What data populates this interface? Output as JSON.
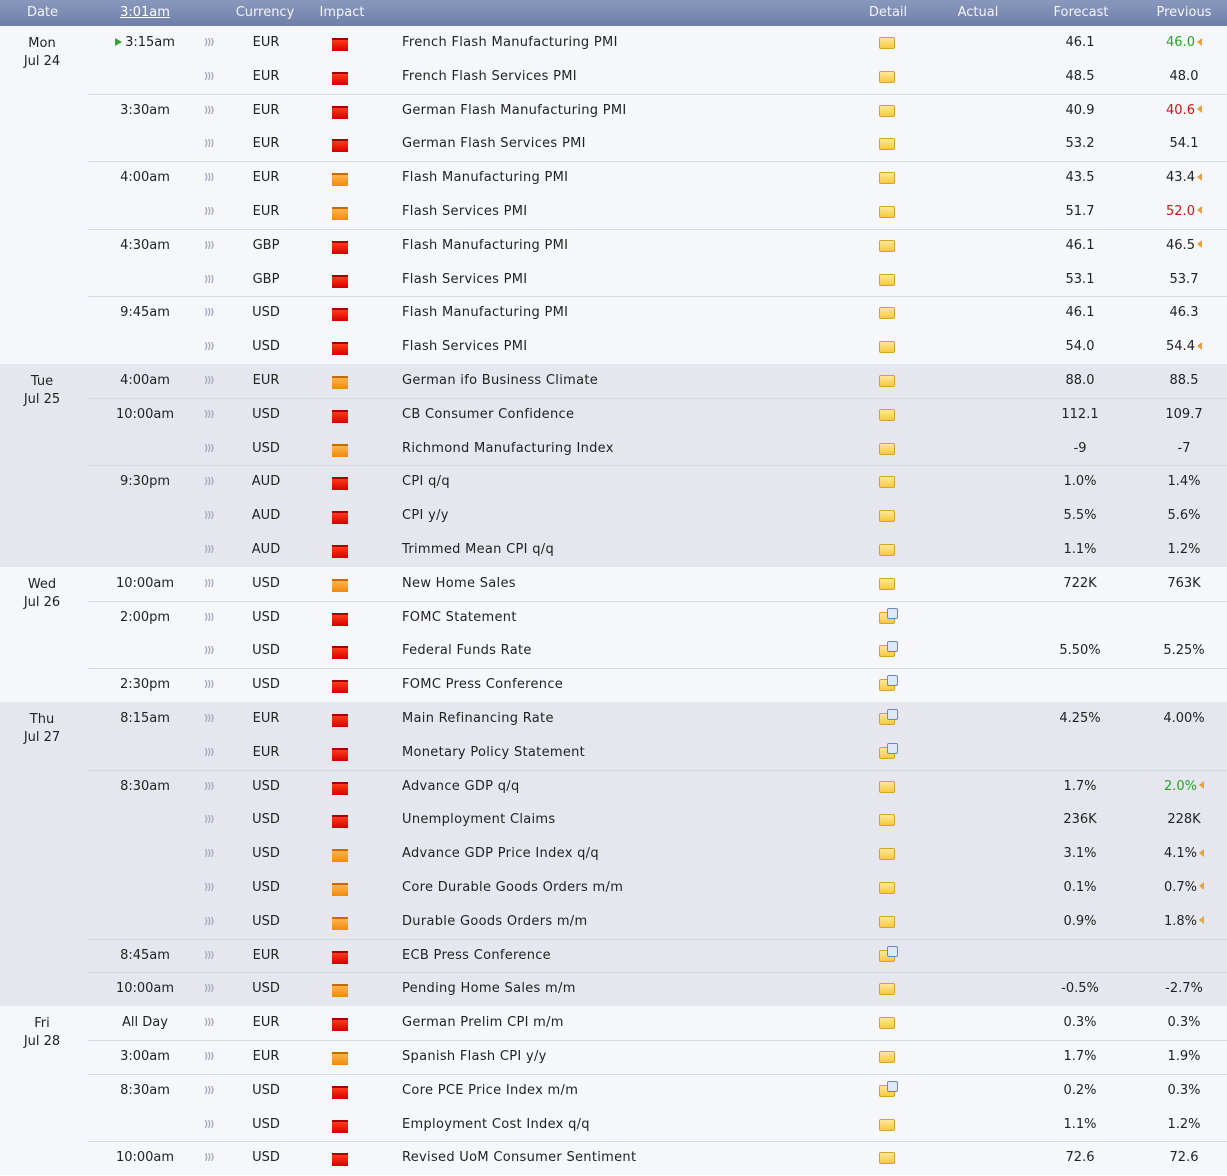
{
  "header": {
    "date": "Date",
    "time": "3:01am",
    "currency": "Currency",
    "impact": "Impact",
    "detail": "Detail",
    "actual": "Actual",
    "forecast": "Forecast",
    "previous": "Previous"
  },
  "colors": {
    "header_bg": "#7b89b0",
    "high_impact": "#e00000",
    "medium_impact": "#f59a20",
    "better": "#2aa12a",
    "worse": "#cc1515",
    "revised_marker": "#f0a030"
  },
  "days": [
    {
      "day": "Mon",
      "date": "Jul 24",
      "shade": "light",
      "rows": [
        {
          "time": "3:15am",
          "current": true,
          "currency": "EUR",
          "impact": "high",
          "title": "French Flash Manufacturing PMI",
          "detail": "folder",
          "forecast": "46.1",
          "previous": "46.0",
          "prev_color": "green",
          "revised": true,
          "sep": true
        },
        {
          "time": "",
          "currency": "EUR",
          "impact": "high",
          "title": "French Flash Services PMI",
          "detail": "folder",
          "forecast": "48.5",
          "previous": "48.0"
        },
        {
          "time": "3:30am",
          "currency": "EUR",
          "impact": "high",
          "title": "German Flash Manufacturing PMI",
          "detail": "folder",
          "forecast": "40.9",
          "previous": "40.6",
          "prev_color": "red",
          "revised": true,
          "sep": true
        },
        {
          "time": "",
          "currency": "EUR",
          "impact": "high",
          "title": "German Flash Services PMI",
          "detail": "folder",
          "forecast": "53.2",
          "previous": "54.1"
        },
        {
          "time": "4:00am",
          "currency": "EUR",
          "impact": "med",
          "title": "Flash Manufacturing PMI",
          "detail": "folder",
          "forecast": "43.5",
          "previous": "43.4",
          "revised": true,
          "sep": true
        },
        {
          "time": "",
          "currency": "EUR",
          "impact": "med",
          "title": "Flash Services PMI",
          "detail": "folder",
          "forecast": "51.7",
          "previous": "52.0",
          "prev_color": "red",
          "revised": true
        },
        {
          "time": "4:30am",
          "currency": "GBP",
          "impact": "high",
          "title": "Flash Manufacturing PMI",
          "detail": "folder",
          "forecast": "46.1",
          "previous": "46.5",
          "revised": true,
          "sep": true
        },
        {
          "time": "",
          "currency": "GBP",
          "impact": "high",
          "title": "Flash Services PMI",
          "detail": "folder",
          "forecast": "53.1",
          "previous": "53.7"
        },
        {
          "time": "9:45am",
          "currency": "USD",
          "impact": "high",
          "title": "Flash Manufacturing PMI",
          "detail": "folder",
          "forecast": "46.1",
          "previous": "46.3",
          "sep": true
        },
        {
          "time": "",
          "currency": "USD",
          "impact": "high",
          "title": "Flash Services PMI",
          "detail": "folder",
          "forecast": "54.0",
          "previous": "54.4",
          "revised": true
        }
      ]
    },
    {
      "day": "Tue",
      "date": "Jul 25",
      "shade": "dark",
      "rows": [
        {
          "time": "4:00am",
          "currency": "EUR",
          "impact": "med",
          "title": "German ifo Business Climate",
          "detail": "folder",
          "forecast": "88.0",
          "previous": "88.5",
          "sep": true
        },
        {
          "time": "10:00am",
          "currency": "USD",
          "impact": "high",
          "title": "CB Consumer Confidence",
          "detail": "folder",
          "forecast": "112.1",
          "previous": "109.7",
          "sep": true
        },
        {
          "time": "",
          "currency": "USD",
          "impact": "med",
          "title": "Richmond Manufacturing Index",
          "detail": "folder",
          "forecast": "-9",
          "previous": "-7"
        },
        {
          "time": "9:30pm",
          "currency": "AUD",
          "impact": "high",
          "title": "CPI q/q",
          "detail": "folder",
          "forecast": "1.0%",
          "previous": "1.4%",
          "sep": true
        },
        {
          "time": "",
          "currency": "AUD",
          "impact": "high",
          "title": "CPI y/y",
          "detail": "folder",
          "forecast": "5.5%",
          "previous": "5.6%"
        },
        {
          "time": "",
          "currency": "AUD",
          "impact": "high",
          "title": "Trimmed Mean CPI q/q",
          "detail": "folder",
          "forecast": "1.1%",
          "previous": "1.2%"
        }
      ]
    },
    {
      "day": "Wed",
      "date": "Jul 26",
      "shade": "light",
      "rows": [
        {
          "time": "10:00am",
          "currency": "USD",
          "impact": "med",
          "title": "New Home Sales",
          "detail": "folder",
          "forecast": "722K",
          "previous": "763K",
          "sep": true
        },
        {
          "time": "2:00pm",
          "currency": "USD",
          "impact": "high",
          "title": "FOMC Statement",
          "detail": "rich",
          "forecast": "",
          "previous": "",
          "sep": true
        },
        {
          "time": "",
          "currency": "USD",
          "impact": "high",
          "title": "Federal Funds Rate",
          "detail": "rich",
          "forecast": "5.50%",
          "previous": "5.25%"
        },
        {
          "time": "2:30pm",
          "currency": "USD",
          "impact": "high",
          "title": "FOMC Press Conference",
          "detail": "rich",
          "forecast": "",
          "previous": "",
          "sep": true
        }
      ]
    },
    {
      "day": "Thu",
      "date": "Jul 27",
      "shade": "dark",
      "rows": [
        {
          "time": "8:15am",
          "currency": "EUR",
          "impact": "high",
          "title": "Main Refinancing Rate",
          "detail": "rich",
          "forecast": "4.25%",
          "previous": "4.00%",
          "sep": true
        },
        {
          "time": "",
          "currency": "EUR",
          "impact": "high",
          "title": "Monetary Policy Statement",
          "detail": "rich",
          "forecast": "",
          "previous": ""
        },
        {
          "time": "8:30am",
          "currency": "USD",
          "impact": "high",
          "title": "Advance GDP q/q",
          "detail": "folder",
          "forecast": "1.7%",
          "previous": "2.0%",
          "prev_color": "green",
          "revised": true,
          "sep": true
        },
        {
          "time": "",
          "currency": "USD",
          "impact": "high",
          "title": "Unemployment Claims",
          "detail": "folder",
          "forecast": "236K",
          "previous": "228K"
        },
        {
          "time": "",
          "currency": "USD",
          "impact": "med",
          "title": "Advance GDP Price Index q/q",
          "detail": "folder",
          "forecast": "3.1%",
          "previous": "4.1%",
          "revised": true
        },
        {
          "time": "",
          "currency": "USD",
          "impact": "med",
          "title": "Core Durable Goods Orders m/m",
          "detail": "folder",
          "forecast": "0.1%",
          "previous": "0.7%",
          "revised": true
        },
        {
          "time": "",
          "currency": "USD",
          "impact": "med",
          "title": "Durable Goods Orders m/m",
          "detail": "folder",
          "forecast": "0.9%",
          "previous": "1.8%",
          "revised": true
        },
        {
          "time": "8:45am",
          "currency": "EUR",
          "impact": "high",
          "title": "ECB Press Conference",
          "detail": "rich",
          "forecast": "",
          "previous": "",
          "sep": true
        },
        {
          "time": "10:00am",
          "currency": "USD",
          "impact": "med",
          "title": "Pending Home Sales m/m",
          "detail": "folder",
          "forecast": "-0.5%",
          "previous": "-2.7%",
          "sep": true
        }
      ]
    },
    {
      "day": "Fri",
      "date": "Jul 28",
      "shade": "light",
      "rows": [
        {
          "time": "All Day",
          "currency": "EUR",
          "impact": "high",
          "title": "German Prelim CPI m/m",
          "detail": "folder",
          "forecast": "0.3%",
          "previous": "0.3%",
          "sep": true
        },
        {
          "time": "3:00am",
          "currency": "EUR",
          "impact": "med",
          "title": "Spanish Flash CPI y/y",
          "detail": "folder",
          "forecast": "1.7%",
          "previous": "1.9%",
          "sep": true
        },
        {
          "time": "8:30am",
          "currency": "USD",
          "impact": "high",
          "title": "Core PCE Price Index m/m",
          "detail": "rich",
          "forecast": "0.2%",
          "previous": "0.3%",
          "sep": true
        },
        {
          "time": "",
          "currency": "USD",
          "impact": "high",
          "title": "Employment Cost Index q/q",
          "detail": "folder",
          "forecast": "1.1%",
          "previous": "1.2%"
        },
        {
          "time": "10:00am",
          "currency": "USD",
          "impact": "high",
          "title": "Revised UoM Consumer Sentiment",
          "detail": "folder",
          "forecast": "72.6",
          "previous": "72.6",
          "sep": true
        }
      ]
    }
  ]
}
